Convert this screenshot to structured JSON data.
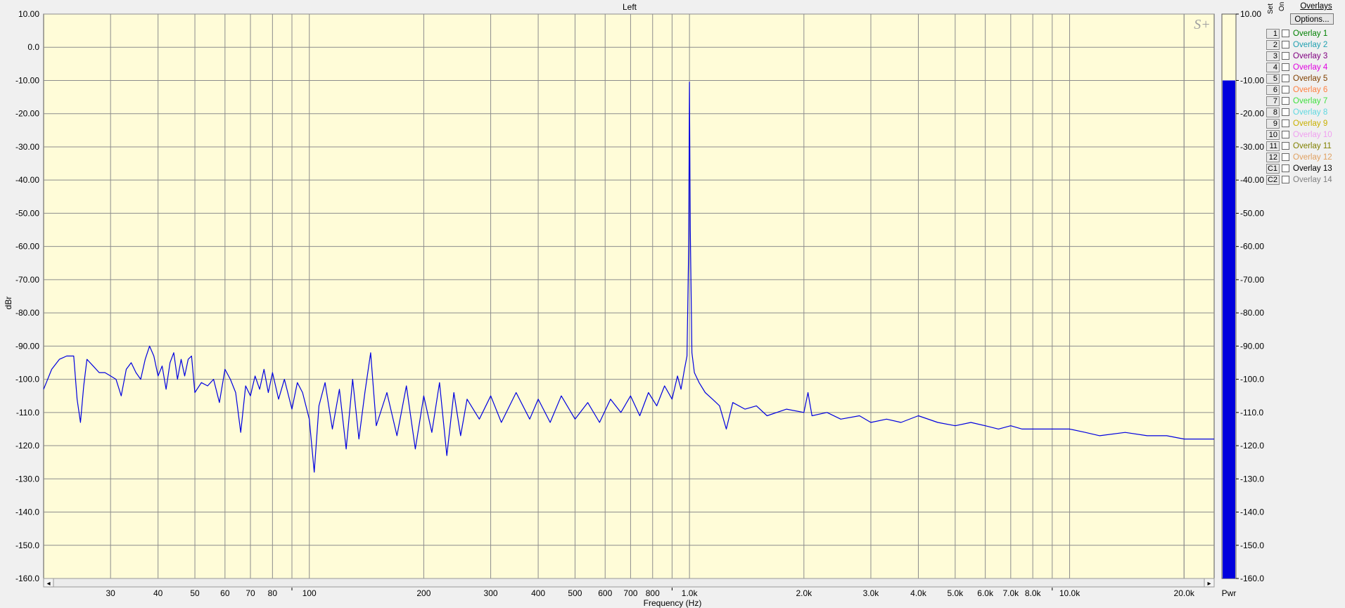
{
  "chart_data": {
    "type": "line",
    "title": "Left",
    "xlabel": "Frequency (Hz)",
    "ylabel": "dBr",
    "x_scale": "log",
    "xlim": [
      20,
      24000
    ],
    "ylim": [
      -160,
      10
    ],
    "grid": true,
    "background": "#fffcd8",
    "y_ticks": [
      "10.00",
      "0.0",
      "-10.00",
      "-20.00",
      "-30.00",
      "-40.00",
      "-50.00",
      "-60.00",
      "-70.00",
      "-80.00",
      "-90.00",
      "-100.0",
      "-110.0",
      "-120.0",
      "-130.0",
      "-140.0",
      "-150.0",
      "-160.0"
    ],
    "y_tick_values": [
      10,
      0,
      -10,
      -20,
      -30,
      -40,
      -50,
      -60,
      -70,
      -80,
      -90,
      -100,
      -110,
      -120,
      -130,
      -140,
      -150,
      -160
    ],
    "x_ticks": [
      {
        "value": 30,
        "label": "30"
      },
      {
        "value": 40,
        "label": "40"
      },
      {
        "value": 50,
        "label": "50"
      },
      {
        "value": 60,
        "label": "60"
      },
      {
        "value": 70,
        "label": "70"
      },
      {
        "value": 80,
        "label": "80"
      },
      {
        "value": 100,
        "label": "100"
      },
      {
        "value": 200,
        "label": "200"
      },
      {
        "value": 300,
        "label": "300"
      },
      {
        "value": 400,
        "label": "400"
      },
      {
        "value": 500,
        "label": "500"
      },
      {
        "value": 600,
        "label": "600"
      },
      {
        "value": 700,
        "label": "700"
      },
      {
        "value": 800,
        "label": "800"
      },
      {
        "value": 1000,
        "label": "1.0k"
      },
      {
        "value": 2000,
        "label": "2.0k"
      },
      {
        "value": 3000,
        "label": "3.0k"
      },
      {
        "value": 4000,
        "label": "4.0k"
      },
      {
        "value": 5000,
        "label": "5.0k"
      },
      {
        "value": 6000,
        "label": "6.0k"
      },
      {
        "value": 7000,
        "label": "7.0k"
      },
      {
        "value": 8000,
        "label": "8.0k"
      },
      {
        "value": 10000,
        "label": "10.0k"
      },
      {
        "value": 20000,
        "label": "20.0k"
      }
    ],
    "series": [
      {
        "color": "#0000e0",
        "points": [
          [
            20,
            -103
          ],
          [
            21,
            -97
          ],
          [
            22,
            -94
          ],
          [
            23,
            -93
          ],
          [
            24,
            -93
          ],
          [
            24.5,
            -106
          ],
          [
            25,
            -113
          ],
          [
            25.5,
            -102
          ],
          [
            26,
            -94
          ],
          [
            27,
            -96
          ],
          [
            28,
            -98
          ],
          [
            29,
            -98
          ],
          [
            30,
            -99
          ],
          [
            31,
            -100
          ],
          [
            32,
            -105
          ],
          [
            33,
            -97
          ],
          [
            34,
            -95
          ],
          [
            35,
            -98
          ],
          [
            36,
            -100
          ],
          [
            37,
            -94
          ],
          [
            38,
            -90
          ],
          [
            39,
            -93
          ],
          [
            40,
            -99
          ],
          [
            41,
            -96
          ],
          [
            42,
            -103
          ],
          [
            43,
            -95
          ],
          [
            44,
            -92
          ],
          [
            45,
            -100
          ],
          [
            46,
            -94
          ],
          [
            47,
            -99
          ],
          [
            48,
            -94
          ],
          [
            49,
            -93
          ],
          [
            50,
            -104
          ],
          [
            52,
            -101
          ],
          [
            54,
            -102
          ],
          [
            56,
            -100
          ],
          [
            58,
            -107
          ],
          [
            60,
            -97
          ],
          [
            62,
            -100
          ],
          [
            64,
            -104
          ],
          [
            66,
            -116
          ],
          [
            68,
            -102
          ],
          [
            70,
            -105
          ],
          [
            72,
            -99
          ],
          [
            74,
            -103
          ],
          [
            76,
            -97
          ],
          [
            78,
            -104
          ],
          [
            80,
            -98
          ],
          [
            83,
            -106
          ],
          [
            86,
            -100
          ],
          [
            90,
            -109
          ],
          [
            93,
            -101
          ],
          [
            96,
            -104
          ],
          [
            100,
            -112
          ],
          [
            103,
            -128
          ],
          [
            106,
            -108
          ],
          [
            110,
            -101
          ],
          [
            115,
            -115
          ],
          [
            120,
            -103
          ],
          [
            125,
            -121
          ],
          [
            130,
            -100
          ],
          [
            135,
            -118
          ],
          [
            140,
            -104
          ],
          [
            145,
            -92
          ],
          [
            150,
            -114
          ],
          [
            160,
            -104
          ],
          [
            170,
            -117
          ],
          [
            180,
            -102
          ],
          [
            190,
            -121
          ],
          [
            200,
            -105
          ],
          [
            210,
            -116
          ],
          [
            220,
            -101
          ],
          [
            230,
            -123
          ],
          [
            240,
            -104
          ],
          [
            250,
            -117
          ],
          [
            260,
            -106
          ],
          [
            280,
            -112
          ],
          [
            300,
            -105
          ],
          [
            320,
            -113
          ],
          [
            350,
            -104
          ],
          [
            380,
            -112
          ],
          [
            400,
            -106
          ],
          [
            430,
            -113
          ],
          [
            460,
            -105
          ],
          [
            500,
            -112
          ],
          [
            540,
            -107
          ],
          [
            580,
            -113
          ],
          [
            620,
            -106
          ],
          [
            660,
            -110
          ],
          [
            700,
            -105
          ],
          [
            740,
            -111
          ],
          [
            780,
            -104
          ],
          [
            820,
            -108
          ],
          [
            860,
            -102
          ],
          [
            900,
            -106
          ],
          [
            930,
            -99
          ],
          [
            950,
            -103
          ],
          [
            970,
            -97
          ],
          [
            985,
            -93
          ],
          [
            995,
            -60
          ],
          [
            1000,
            -10.5
          ],
          [
            1005,
            -55
          ],
          [
            1015,
            -92
          ],
          [
            1030,
            -98
          ],
          [
            1060,
            -101
          ],
          [
            1100,
            -104
          ],
          [
            1150,
            -106
          ],
          [
            1200,
            -108
          ],
          [
            1250,
            -115
          ],
          [
            1300,
            -107
          ],
          [
            1400,
            -109
          ],
          [
            1500,
            -108
          ],
          [
            1600,
            -111
          ],
          [
            1800,
            -109
          ],
          [
            2000,
            -110
          ],
          [
            2050,
            -104
          ],
          [
            2100,
            -111
          ],
          [
            2300,
            -110
          ],
          [
            2500,
            -112
          ],
          [
            2800,
            -111
          ],
          [
            3000,
            -113
          ],
          [
            3300,
            -112
          ],
          [
            3600,
            -113
          ],
          [
            4000,
            -111
          ],
          [
            4500,
            -113
          ],
          [
            5000,
            -114
          ],
          [
            5500,
            -113
          ],
          [
            6000,
            -114
          ],
          [
            6500,
            -115
          ],
          [
            7000,
            -114
          ],
          [
            7500,
            -115
          ],
          [
            8000,
            -115
          ],
          [
            9000,
            -115
          ],
          [
            10000,
            -115
          ],
          [
            11000,
            -116
          ],
          [
            12000,
            -117
          ],
          [
            14000,
            -116
          ],
          [
            16000,
            -117
          ],
          [
            18000,
            -117
          ],
          [
            20000,
            -118
          ],
          [
            22000,
            -118
          ],
          [
            24000,
            -118
          ]
        ]
      }
    ],
    "meter": {
      "label": "Pwr",
      "value": -10.0,
      "min": -160,
      "max": 10,
      "fill_color": "#0000dd",
      "background": "#fffcd8",
      "ticks": [
        "10.00",
        "-10.00",
        "-20.00",
        "-30.00",
        "-40.00",
        "-50.00",
        "-60.00",
        "-70.00",
        "-80.00",
        "-90.00",
        "-100.0",
        "-110.0",
        "-120.0",
        "-130.0",
        "-140.0",
        "-150.0",
        "-160.0"
      ],
      "tick_values": [
        10,
        -10,
        -20,
        -30,
        -40,
        -50,
        -60,
        -70,
        -80,
        -90,
        -100,
        -110,
        -120,
        -130,
        -140,
        -150,
        -160
      ]
    }
  },
  "watermark": "S+",
  "scrollbar": {
    "left_arrow": "◂",
    "right_arrow": "▸"
  },
  "overlays": {
    "title": "Overlays",
    "set_label": "Set",
    "on_label": "On",
    "options_label": "Options...",
    "items": [
      {
        "button": "1",
        "label": "Overlay 1",
        "color": "#008000"
      },
      {
        "button": "2",
        "label": "Overlay 2",
        "color": "#20a0b0"
      },
      {
        "button": "3",
        "label": "Overlay 3",
        "color": "#800080"
      },
      {
        "button": "4",
        "label": "Overlay 4",
        "color": "#e000e0"
      },
      {
        "button": "5",
        "label": "Overlay 5",
        "color": "#804000"
      },
      {
        "button": "6",
        "label": "Overlay 6",
        "color": "#ff8040"
      },
      {
        "button": "7",
        "label": "Overlay 7",
        "color": "#40e040"
      },
      {
        "button": "8",
        "label": "Overlay 8",
        "color": "#60d8e0"
      },
      {
        "button": "9",
        "label": "Overlay 9",
        "color": "#c8b000"
      },
      {
        "button": "10",
        "label": "Overlay 10",
        "color": "#f0a0f0"
      },
      {
        "button": "11",
        "label": "Overlay 11",
        "color": "#808000"
      },
      {
        "button": "12",
        "label": "Overlay 12",
        "color": "#e0a060"
      },
      {
        "button": "C1",
        "label": "Overlay 13",
        "color": "#000000"
      },
      {
        "button": "C2",
        "label": "Overlay 14",
        "color": "#808080"
      }
    ]
  }
}
